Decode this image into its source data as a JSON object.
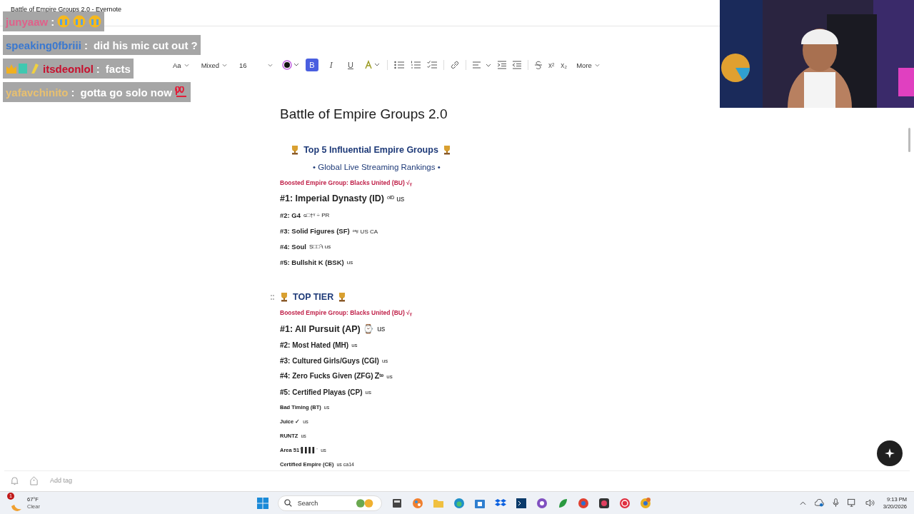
{
  "window": {
    "title": "Battle of Empire Groups 2.0 - Evernote"
  },
  "chat": [
    {
      "user": "junyaaw",
      "color": "#e0608a",
      "separator": ":"
    },
    {
      "user": "speaking0fbriii",
      "color": "#3a78d0",
      "separator": ":",
      "text": "did his mic cut out ?"
    },
    {
      "user": "itsdeonlol",
      "color": "#c8102e",
      "separator": ":",
      "text": "facts"
    },
    {
      "user": "yafavchinito",
      "color": "#e8c070",
      "separator": ":",
      "text": "gotta go solo now"
    }
  ],
  "toolbar": {
    "dropdowns": [
      "Aa",
      "Mixed",
      "16"
    ],
    "format": [
      {
        "label": "B",
        "selected": true
      },
      {
        "label": "I",
        "selected": false
      },
      {
        "label": "U",
        "selected": false
      }
    ],
    "script": [
      "x²",
      "x₂"
    ],
    "more": "More"
  },
  "note": {
    "lines": [
      {
        "kind": "title",
        "text": "Battle of Empire Groups 2.0"
      },
      {
        "kind": "banner",
        "text": "Top 5 Influential Empire Groups"
      },
      {
        "kind": "subtitle",
        "text": "• Global Live Streaming Rankings •"
      },
      {
        "kind": "boosted",
        "text": "Boosted Empire Group: Blacks United (BU) √ᵧ"
      },
      {
        "kind": "rank-large",
        "text": "#1: Imperial Dynasty (ID)",
        "suffix": "ᵒᴵᴰ us"
      },
      {
        "kind": "rank",
        "text": "#2:  G4",
        "suffix": "ɢ□†ᵞ ÷ PR"
      },
      {
        "kind": "rank",
        "text": "#3: Solid Figures (SF)",
        "suffix": "ᵒˢꜰ US CA"
      },
      {
        "kind": "rank",
        "text": "#4:  Soul",
        "suffix": "Ṣ□□ˀɩ us"
      },
      {
        "kind": "rank",
        "text": "#5:  Bullshit K (BSK)",
        "suffix": "us"
      },
      {
        "kind": "heading",
        "text": "TOP TIER"
      },
      {
        "kind": "boosted",
        "text": "Boosted Empire Group: Blacks United (BU) √ᵧ"
      },
      {
        "kind": "rank-large",
        "text": "#1: All Pursuit (AP) ⌚",
        "suffix": "us"
      },
      {
        "kind": "rank-md",
        "text": "#2: Most Hated (MH)",
        "suffix": "us"
      },
      {
        "kind": "rank-md",
        "text": "#3: Cultured Girls/Guys (CGI)",
        "suffix": "us"
      },
      {
        "kind": "rank-md",
        "text": "#4: Zero Fucks Given (ZFG) Ꮓᵗᵉ",
        "suffix": "us"
      },
      {
        "kind": "rank-md",
        "text": "#5: Certified Playas (CP)",
        "suffix": "us"
      },
      {
        "kind": "small",
        "text": "Bad Timing (BT)",
        "suffix": "us"
      },
      {
        "kind": "small",
        "text": "Juice ✓",
        "suffix": "us"
      },
      {
        "kind": "small",
        "text": "RUNTZ",
        "suffix": "us"
      },
      {
        "kind": "small",
        "text": "Area 51ˈ▌▌▌▌ˈ",
        "suffix": "us"
      },
      {
        "kind": "small",
        "text": "Certified Empire (CE)",
        "suffix": "us ca14"
      }
    ]
  },
  "footer": {
    "tag_placeholder": "Add tag"
  },
  "taskbar": {
    "weather": {
      "temp": "67°F",
      "condition": "Clear",
      "badge": "1"
    },
    "search": {
      "placeholder": "Search"
    },
    "time": "9:13 PM",
    "date": "3/20/2026"
  }
}
